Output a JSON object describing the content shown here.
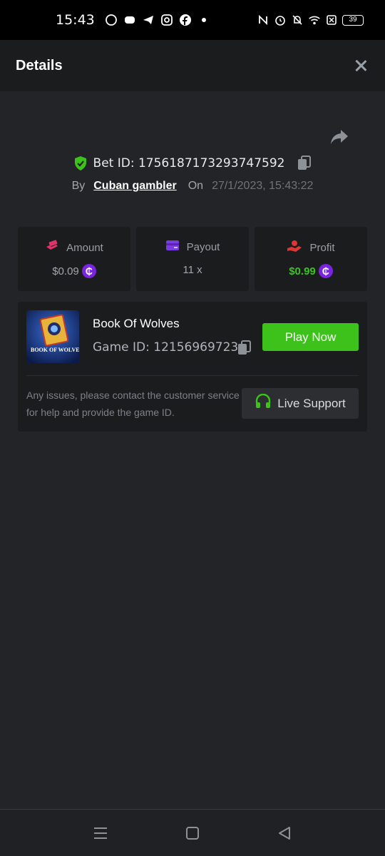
{
  "status_bar": {
    "time": "15:43",
    "battery": "39"
  },
  "header": {
    "title": "Details"
  },
  "bet": {
    "id_label": "Bet ID: 1756187173293747592",
    "by_label": "By",
    "user": "Cuban gambler",
    "on_label": "On",
    "date": "27/1/2023, 15:43:22"
  },
  "stats": [
    {
      "label": "Amount",
      "value": "$0.09",
      "icon": "money-hand-icon",
      "color": "#e0336a"
    },
    {
      "label": "Payout",
      "value": "11 x",
      "icon": "card-icon",
      "color": "#7a3be0"
    },
    {
      "label": "Profit",
      "value": "$0.99",
      "icon": "hand-profit-icon",
      "color": "#e03535"
    }
  ],
  "game": {
    "name": "Book Of Wolves",
    "id_label": "Game ID: 12156969723",
    "thumb_text": "BOOK OF WOLVES",
    "play_label": "Play Now",
    "issue_text": "Any issues, please contact the customer service for help and provide the game ID.",
    "support_label": "Live Support"
  },
  "colors": {
    "accent_green": "#3cc21b",
    "coin_purple": "#7a24e0"
  }
}
